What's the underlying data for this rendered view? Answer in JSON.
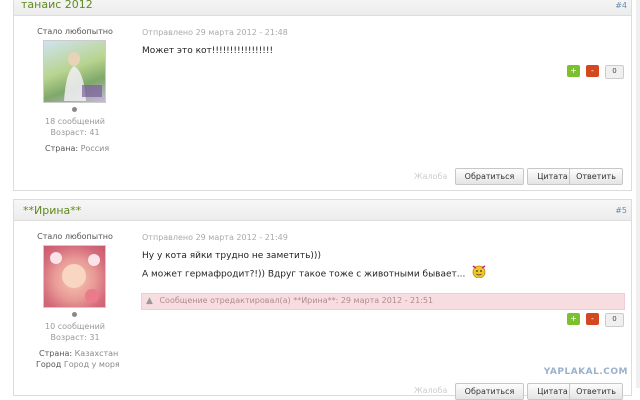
{
  "posts": [
    {
      "author": "танаис 2012",
      "number": "#4",
      "rank": "Стало любопытно",
      "messages": "18 сообщений",
      "age": "Возраст: 41",
      "country_label": "Страна:",
      "country": "Россия",
      "date": "Отправлено 29 марта 2012 - 21:48",
      "lines": [
        "Может это кот!!!!!!!!!!!!!!!!!"
      ],
      "votes": "0"
    },
    {
      "author": "**Ирина**",
      "number": "#5",
      "rank": "Стало любопытно",
      "messages": "10 сообщений",
      "age": "Возраст: 31",
      "country_label": "Страна:",
      "country": "Казахстан",
      "city_label": "Город",
      "city": "Город у моря",
      "date": "Отправлено 29 марта 2012 - 21:49",
      "lines": [
        "Ну у кота яйки трудно не заметить)))",
        "А может гермафродит?!)) Вдруг такое тоже с животными бывает..."
      ],
      "edit_note": "Сообщение отредактировал(а) **Ирина**: 29 марта 2012 - 21:51",
      "votes": "0"
    }
  ],
  "actions": {
    "complaint": "Жалоба",
    "reply_to": "Обратиться",
    "quote": "Цитата",
    "answer": "Ответить"
  },
  "vote_up": "+",
  "vote_down": "-",
  "watermark": "YAPLAKAL.COM",
  "icons": {
    "warning": "warning-triangle-icon",
    "emoticon": "smiley-emoticon-icon"
  }
}
